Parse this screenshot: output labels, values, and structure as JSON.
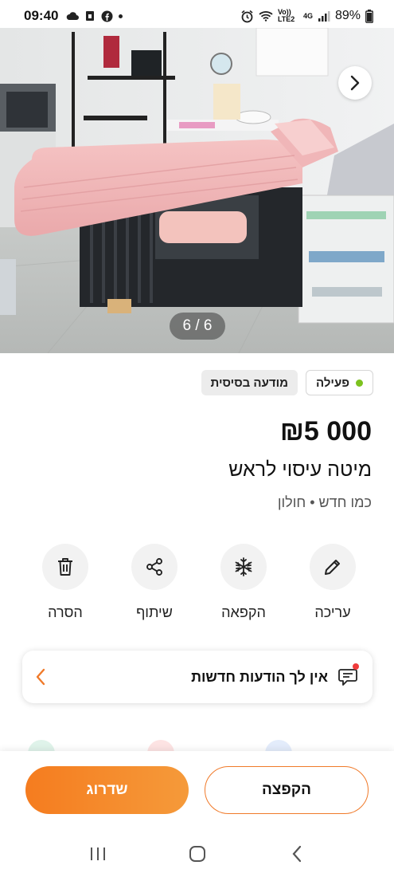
{
  "status_bar": {
    "time": "09:40",
    "battery": "89%",
    "network_label": "4G",
    "volte_label": "Vo)) LTE2"
  },
  "gallery": {
    "counter": "6 / 6"
  },
  "badges": {
    "basic": "מודעה בסיסית",
    "status": "פעילה",
    "status_color": "#7cc21e"
  },
  "listing": {
    "price": "₪5 000",
    "title": "מיטה עיסוי לראש",
    "subtitle": "כמו חדש • חולון"
  },
  "actions": [
    {
      "label": "עריכה",
      "icon": "pencil-icon"
    },
    {
      "label": "הקפאה",
      "icon": "snowflake-icon"
    },
    {
      "label": "שיתוף",
      "icon": "share-icon"
    },
    {
      "label": "הסרה",
      "icon": "trash-icon"
    }
  ],
  "messages": {
    "text": "אין לך הודעות חדשות"
  },
  "bottom_bar": {
    "bump_label": "הקפצה",
    "upgrade_label": "שדרוג"
  },
  "colors": {
    "accent": "#f57c1f",
    "notification": "#ef3b3b"
  }
}
